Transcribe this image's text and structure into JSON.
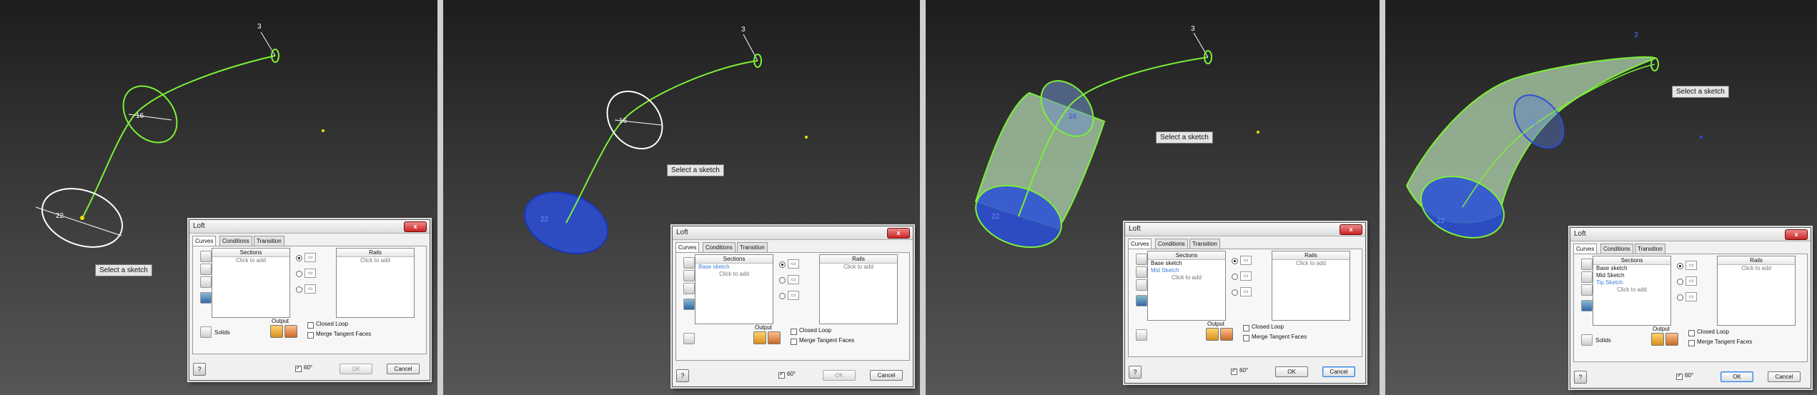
{
  "viewport": {
    "panels": [
      {
        "tip": "Select a sketch",
        "dim_a": "16",
        "dim_b": "22",
        "dim_c": "3"
      },
      {
        "tip": "Select a sketch",
        "dim_a": "16",
        "dim_b": "22",
        "dim_c": "3"
      },
      {
        "tip": "Select a sketch",
        "dim_a": "16",
        "dim_b": "22",
        "dim_c": "3"
      },
      {
        "tip": "Select a sketch",
        "dim_a": "16",
        "dim_b": "22",
        "dim_c": "3"
      }
    ]
  },
  "dialogs": [
    {
      "title": "Loft",
      "close": "x",
      "tabs": [
        "Curves",
        "Conditions",
        "Transition"
      ],
      "sections_header": "Sections",
      "rails_header": "Rails",
      "sections": [],
      "sections_hint": "Click to add",
      "rails_hint": "Click to add",
      "solids_label": "Solids",
      "output_label": "Output",
      "closed_loop": "Closed Loop",
      "merge_faces": "Merge Tangent Faces",
      "ok": "OK",
      "cancel": "Cancel",
      "help": "?",
      "preview": "60°"
    },
    {
      "title": "Loft",
      "close": "x",
      "tabs": [
        "Curves",
        "Conditions",
        "Transition"
      ],
      "sections_header": "Sections",
      "rails_header": "Rails",
      "sections": [
        "Base sketch"
      ],
      "sections_hint": "Click to add",
      "rails_hint": "Click to add",
      "output_label": "Output",
      "closed_loop": "Closed Loop",
      "merge_faces": "Merge Tangent Faces",
      "ok": "OK",
      "cancel": "Cancel",
      "help": "?",
      "preview": "60°"
    },
    {
      "title": "Loft",
      "close": "x",
      "tabs": [
        "Curves",
        "Conditions",
        "Transition"
      ],
      "sections_header": "Sections",
      "rails_header": "Rails",
      "sections": [
        "Base sketch",
        "Mid Sketch"
      ],
      "sections_hint": "Click to add",
      "rails_hint": "Click to add",
      "output_label": "Output",
      "closed_loop": "Closed Loop",
      "merge_faces": "Merge Tangent Faces",
      "ok": "OK",
      "cancel": "Cancel",
      "help": "?",
      "preview": "60°"
    },
    {
      "title": "Loft",
      "close": "x",
      "tabs": [
        "Curves",
        "Conditions",
        "Transition"
      ],
      "sections_header": "Sections",
      "rails_header": "Rails",
      "sections": [
        "Base sketch",
        "Mid Sketch",
        "Tip Sketch"
      ],
      "sections_hint": "Click to add",
      "rails_hint": "Click to add",
      "solids_label": "Solids",
      "output_label": "Output",
      "closed_loop": "Closed Loop",
      "merge_faces": "Merge Tangent Faces",
      "ok": "OK",
      "cancel": "Cancel",
      "help": "?",
      "preview": "60°"
    }
  ],
  "colors": {
    "sketch": "#7df037",
    "selected": "#2a4fd8",
    "loft": "#a9c9a6"
  }
}
